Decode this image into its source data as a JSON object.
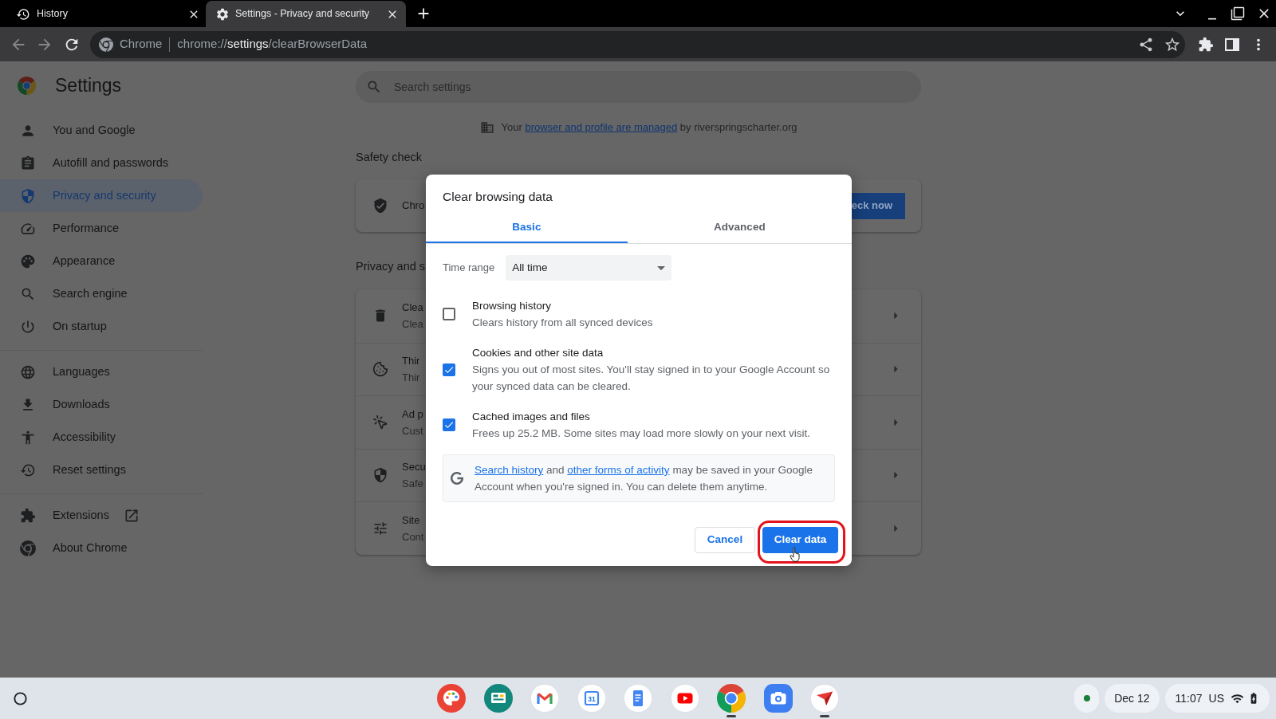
{
  "browser_tabs": [
    {
      "title": "History",
      "selected": false
    },
    {
      "title": "Settings - Privacy and security",
      "selected": true
    }
  ],
  "toolbar": {
    "site_label": "Chrome",
    "url": {
      "scheme": "chrome://",
      "host": "settings",
      "path": "/clearBrowserData"
    }
  },
  "settings": {
    "title": "Settings",
    "sidebar": {
      "sections": [
        {
          "items": [
            {
              "label": "You and Google",
              "selected": false,
              "external": false
            },
            {
              "label": "Autofill and passwords",
              "selected": false,
              "external": false
            },
            {
              "label": "Privacy and security",
              "selected": true,
              "external": false
            },
            {
              "label": "Performance",
              "selected": false,
              "external": false
            },
            {
              "label": "Appearance",
              "selected": false,
              "external": false
            },
            {
              "label": "Search engine",
              "selected": false,
              "external": false
            },
            {
              "label": "On startup",
              "selected": false,
              "external": false
            }
          ]
        },
        {
          "items": [
            {
              "label": "Languages",
              "selected": false,
              "external": false
            },
            {
              "label": "Downloads",
              "selected": false,
              "external": false
            },
            {
              "label": "Accessibility",
              "selected": false,
              "external": false
            },
            {
              "label": "Reset settings",
              "selected": false,
              "external": false
            }
          ]
        },
        {
          "items": [
            {
              "label": "Extensions",
              "selected": false,
              "external": true
            },
            {
              "label": "About Chrome",
              "selected": false,
              "external": false
            }
          ]
        }
      ]
    },
    "search": {
      "placeholder": "Search settings"
    },
    "managed_notice": {
      "parts": [
        {
          "kind": "text",
          "text": "Your "
        },
        {
          "kind": "link",
          "text": "browser and profile are managed"
        },
        {
          "kind": "text",
          "text": " by riverspringscharter.org"
        }
      ]
    },
    "sections": [
      {
        "heading": "Safety check",
        "kind": "action",
        "rows": [
          {
            "title": "Chro"
          }
        ],
        "button": "eck now"
      },
      {
        "heading": "Privacy and s",
        "kind": "list",
        "rows": [
          {
            "title": "Clea",
            "subtitle": "Clea"
          },
          {
            "title": "Thir",
            "subtitle": "Thir"
          },
          {
            "title": "Ad p",
            "subtitle": "Cust"
          },
          {
            "title": "Secu",
            "subtitle": "Safe"
          },
          {
            "title": "Site",
            "subtitle": "Cont"
          }
        ]
      }
    ]
  },
  "dialog": {
    "title": "Clear browsing data",
    "tabs": [
      {
        "label": "Basic",
        "selected": true
      },
      {
        "label": "Advanced",
        "selected": false
      }
    ],
    "time_range": {
      "label": "Time range",
      "value": "All time"
    },
    "options": [
      {
        "title": "Browsing history",
        "description": "Clears history from all synced devices",
        "checked": false
      },
      {
        "title": "Cookies and other site data",
        "description": "Signs you out of most sites. You'll stay signed in to your Google Account so your synced data can be cleared.",
        "checked": true
      },
      {
        "title": "Cached images and files",
        "description": "Frees up 25.2 MB. Some sites may load more slowly on your next visit.",
        "checked": true
      }
    ],
    "notice": {
      "parts": [
        {
          "kind": "link",
          "text": "Search history"
        },
        {
          "kind": "text",
          "text": " and "
        },
        {
          "kind": "link",
          "text": "other forms of activity"
        },
        {
          "kind": "text",
          "text": " may be saved in your Google Account when you're signed in. You can delete them anytime."
        }
      ]
    },
    "buttons": [
      {
        "label": "Cancel",
        "kind": "secondary",
        "highlighted": false
      },
      {
        "label": "Clear data",
        "kind": "primary",
        "highlighted": true
      }
    ]
  },
  "taskbar": {
    "apps": [
      {
        "kind": "palette",
        "running": false
      },
      {
        "kind": "board",
        "running": false
      },
      {
        "kind": "mail",
        "running": false
      },
      {
        "kind": "calendar",
        "glyph": "31",
        "running": false
      },
      {
        "kind": "document",
        "running": false
      },
      {
        "kind": "video",
        "running": false
      },
      {
        "kind": "browser",
        "running": true
      },
      {
        "kind": "camera",
        "running": false
      },
      {
        "kind": "pen",
        "running": true
      }
    ],
    "date": "Dec 12",
    "time": "11:07",
    "input_method": "US"
  }
}
